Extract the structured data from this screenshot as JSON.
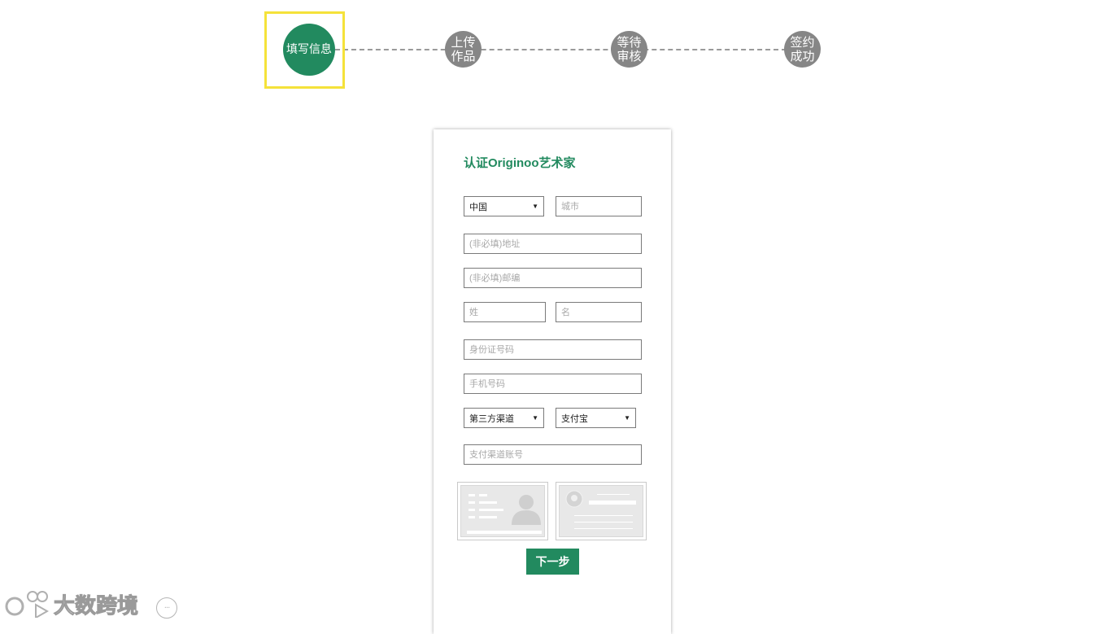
{
  "stepper": {
    "steps": [
      {
        "label": "填写信息",
        "active": true
      },
      {
        "label": "上传\n作品",
        "active": false
      },
      {
        "label": "等待\n审核",
        "active": false
      },
      {
        "label": "签约\n成功",
        "active": false
      }
    ]
  },
  "form": {
    "title": "认证Originoo艺术家",
    "country_select": "中国",
    "city_placeholder": "城市",
    "address_placeholder": "(非必填)地址",
    "postcode_placeholder": "(非必填)邮编",
    "surname_placeholder": "姓",
    "given_name_placeholder": "名",
    "id_number_placeholder": "身份证号码",
    "phone_placeholder": "手机号码",
    "channel_select": "第三方渠道",
    "payment_select": "支付宝",
    "account_placeholder": "支付渠道账号",
    "next_button": "下一步"
  },
  "watermark": {
    "text": "大数跨境",
    "more": "···"
  },
  "colors": {
    "accent": "#228a5f",
    "step_inactive": "#868686",
    "highlight": "#f5e23a"
  },
  "icons": {
    "dropdown": "triangle-down-icon",
    "id_front": "id-card-front-icon",
    "id_back": "id-card-back-icon"
  }
}
